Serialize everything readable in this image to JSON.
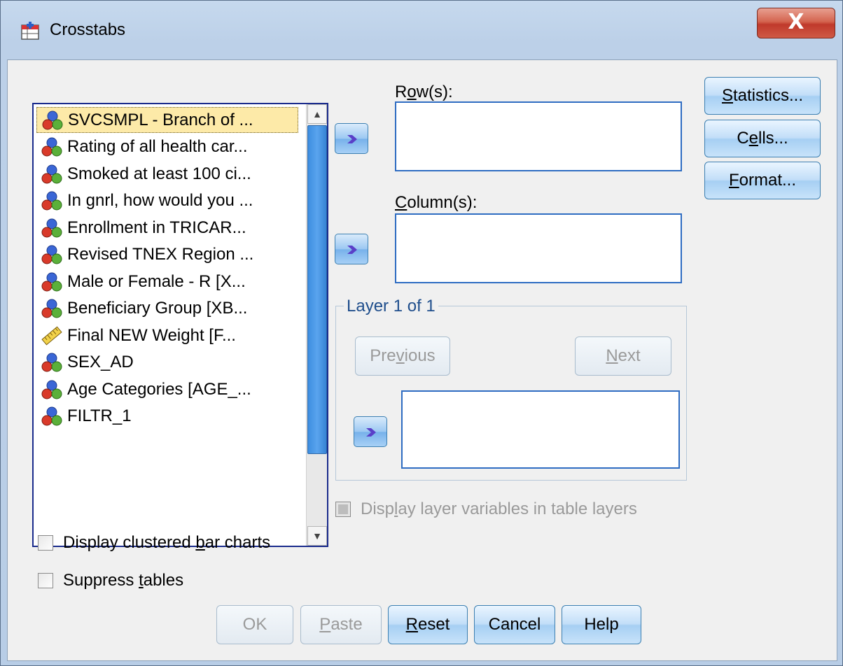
{
  "window": {
    "title": "Crosstabs",
    "close_label": "X"
  },
  "variables": [
    {
      "label": "SVCSMPL - Branch of ...",
      "icon": "nominal-icon",
      "selected": true
    },
    {
      "label": "Rating of all health car...",
      "icon": "nominal-icon"
    },
    {
      "label": "Smoked at least 100 ci...",
      "icon": "nominal-icon"
    },
    {
      "label": "In gnrl, how would you ...",
      "icon": "nominal-icon"
    },
    {
      "label": "Enrollment in TRICAR...",
      "icon": "nominal-icon"
    },
    {
      "label": "Revised TNEX Region ...",
      "icon": "nominal-icon"
    },
    {
      "label": "Male or Female  - R [X...",
      "icon": "nominal-icon"
    },
    {
      "label": "Beneficiary Group [XB...",
      "icon": "nominal-icon"
    },
    {
      "label": "Final NEW Weight [F...",
      "icon": "scale-ruler-icon"
    },
    {
      "label": "SEX_AD",
      "icon": "nominal-icon"
    },
    {
      "label": "Age Categories [AGE_...",
      "icon": "nominal-icon"
    },
    {
      "label": "FILTR_1",
      "icon": "nominal-icon"
    }
  ],
  "rows": {
    "label_pre": "R",
    "label_u": "o",
    "label_post": "w(s):"
  },
  "columns": {
    "label_pre": "",
    "label_u": "C",
    "label_post": "olumn(s):"
  },
  "layer": {
    "legend": "Layer 1 of 1",
    "previous": {
      "pre": "Pre",
      "u": "v",
      "post": "ious"
    },
    "next": {
      "pre": "",
      "u": "N",
      "post": "ext"
    },
    "display_layer_vars": {
      "pre": "Disp",
      "u": "l",
      "post": "ay layer variables in table layers"
    }
  },
  "side_buttons": {
    "statistics": {
      "pre": "",
      "u": "S",
      "post": "tatistics..."
    },
    "cells": {
      "pre": "C",
      "u": "e",
      "post": "lls..."
    },
    "format": {
      "pre": "",
      "u": "F",
      "post": "ormat..."
    }
  },
  "options": {
    "clustered_bar": {
      "pre": "Display clustered ",
      "u": "b",
      "post": "ar charts"
    },
    "suppress_tables": {
      "pre": "Suppress ",
      "u": "t",
      "post": "ables"
    }
  },
  "footer": {
    "ok": "OK",
    "paste": {
      "pre": "",
      "u": "P",
      "post": "aste"
    },
    "reset": {
      "pre": "",
      "u": "R",
      "post": "eset"
    },
    "cancel": "Cancel",
    "help": "Help"
  },
  "colors": {
    "accent": "#1f4e8c",
    "selection": "#fdeaa8",
    "close": "#c0392b"
  }
}
